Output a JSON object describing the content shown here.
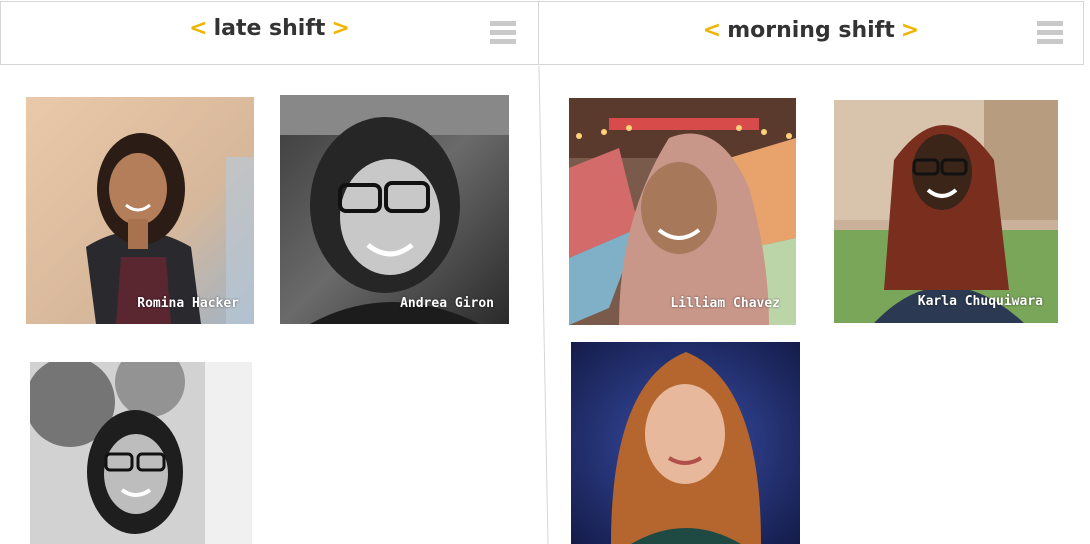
{
  "columns": [
    {
      "title": "late shift",
      "prev_label": "<",
      "next_label": ">",
      "menu_icon": "hamburger-menu-icon",
      "members": [
        {
          "name": "Romina Hacker"
        },
        {
          "name": "Andrea Giron"
        },
        {
          "name": ""
        }
      ]
    },
    {
      "title": "morning shift",
      "prev_label": "<",
      "next_label": ">",
      "menu_icon": "hamburger-menu-icon",
      "members": [
        {
          "name": "Lilliam Chavez"
        },
        {
          "name": "Karla Chuquiwara"
        },
        {
          "name": ""
        }
      ]
    }
  ],
  "colors": {
    "accent": "#f0b400",
    "title_text": "#333333",
    "border": "#d6d6d6",
    "menu_icon": "#c9c9c9",
    "name_text": "#ffffff"
  }
}
